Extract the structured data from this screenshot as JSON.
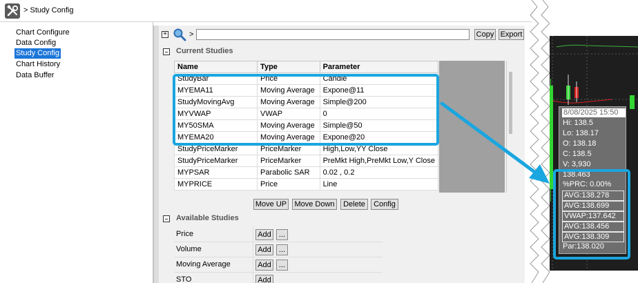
{
  "title_bar": {
    "breadcrumb": "> Study Config",
    "icon": "tools-icon"
  },
  "nav": {
    "items": [
      {
        "label": "Chart Configure",
        "active": false
      },
      {
        "label": "Data Config",
        "active": false
      },
      {
        "label": "Study Config",
        "active": true
      },
      {
        "label": "Chart History",
        "active": false
      },
      {
        "label": "Data Buffer",
        "active": false
      }
    ]
  },
  "toolbar": {
    "expand_symbol": "+",
    "path_prefix": ">",
    "search_value": "",
    "copy_label": "Copy",
    "export_label": "Export"
  },
  "current_studies": {
    "title": "Current Studies",
    "columns": [
      "Name",
      "Type",
      "Parameter"
    ],
    "rows": [
      [
        "StudyBar",
        "Price",
        "Candle"
      ],
      [
        "MYEMA11",
        "Moving Average",
        "Expone@11"
      ],
      [
        "StudyMovingAvg",
        "Moving Average",
        "Simple@200"
      ],
      [
        "MYVWAP",
        "VWAP",
        "0"
      ],
      [
        "MY50SMA",
        "Moving Average",
        "Simple@50"
      ],
      [
        "MYEMA20",
        "Moving Average",
        "Expone@20"
      ],
      [
        "StudyPriceMarker",
        "PriceMarker",
        "High,Low,YY Close"
      ],
      [
        "StudyPriceMarker",
        "PriceMarker",
        "PreMkt High,PreMkt Low,Y Close"
      ],
      [
        "MYPSAR",
        "Parabolic SAR",
        "0.02 , 0.2"
      ],
      [
        "MYPRICE",
        "Price",
        "Line"
      ]
    ],
    "buttons": {
      "move_up": "Move UP",
      "move_down": "Move Down",
      "delete": "Delete",
      "config": "Config"
    }
  },
  "available_studies": {
    "title": "Available Studies",
    "add_label": "Add",
    "more_label": "...",
    "items": [
      "Price",
      "Volume",
      "Moving Average",
      "STO"
    ]
  },
  "chart_tooltip": {
    "date": "8/08/2025 15:50",
    "lines": [
      "Hi: 138.5",
      "Lo: 138.17",
      "O: 138.18",
      "C: 138.5",
      "V: 3,930",
      "138.463",
      "%PRC: 0.00%"
    ],
    "avg_lines": [
      "AVG:138.278",
      "AVG:138.699",
      "VWAP:137.642",
      "AVG:138.456",
      "AVG:138.309",
      "Par:138.020"
    ]
  },
  "colors": {
    "accent_callout": "#1aa6df",
    "nav_active": "#1c76d8",
    "candle_up": "#33d633",
    "candle_down": "#d62020",
    "chart_bg": "#1e1e1e"
  }
}
